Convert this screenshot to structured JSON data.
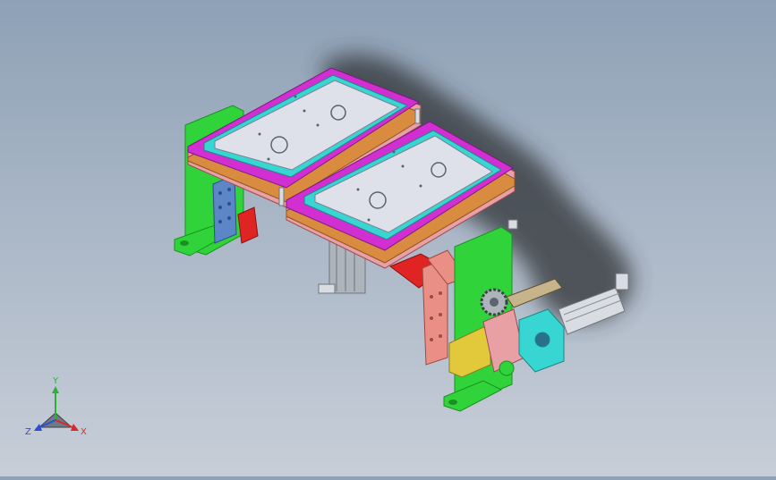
{
  "viewport": {
    "model_name": "",
    "colors": {
      "background_top": "#8ea1b6",
      "background_bottom": "#c7ced8",
      "shadow": "#2e3135",
      "plate": "#dfe1ea",
      "cyan": "#37d6d2",
      "magenta": "#d12fd1",
      "orange": "#d98b3f",
      "green": "#30d43a",
      "red": "#e02424",
      "salmon": "#ea8f86",
      "yellow": "#e1c93b",
      "blue_block": "#5b86c8",
      "steel": "#aeb4bb",
      "pink": "#e9a0a5"
    }
  },
  "triad": {
    "x_label": "X",
    "y_label": "Y",
    "z_label": "Z"
  }
}
